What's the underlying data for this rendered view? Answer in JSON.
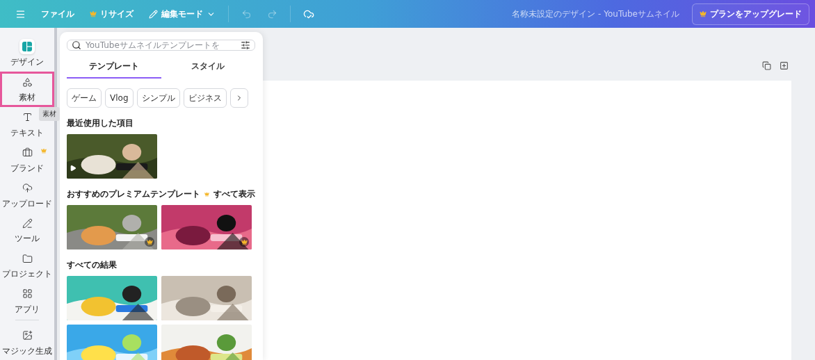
{
  "topbar": {
    "menu_items": [
      {
        "label": "ファイル",
        "crown": false
      },
      {
        "label": "リサイズ",
        "crown": true
      }
    ],
    "edit_mode": "編集モード",
    "undo_enabled": false,
    "redo_enabled": false,
    "document_title": "名称未設定のデザイン - YouTubeサムネイル",
    "upgrade_button": "プランをアップグレード"
  },
  "sidebar": {
    "items": [
      {
        "kind": "design",
        "label": "デザイン",
        "selected": true,
        "highlighted": false,
        "crown": false
      },
      {
        "kind": "elements",
        "label": "素材",
        "selected": false,
        "highlighted": true,
        "crown": false
      },
      {
        "kind": "text",
        "label": "テキスト",
        "selected": false,
        "highlighted": false,
        "crown": false
      },
      {
        "kind": "brand",
        "label": "ブランド",
        "selected": false,
        "highlighted": false,
        "crown": true
      },
      {
        "kind": "upload",
        "label": "アップロード",
        "selected": false,
        "highlighted": false,
        "crown": false
      },
      {
        "kind": "tools",
        "label": "ツール",
        "selected": false,
        "highlighted": false,
        "crown": false
      },
      {
        "kind": "projects",
        "label": "プロジェクト",
        "selected": false,
        "highlighted": false,
        "crown": false
      },
      {
        "kind": "apps",
        "label": "アプリ",
        "selected": false,
        "highlighted": false,
        "crown": false
      },
      {
        "kind": "magic",
        "label": "マジック生成",
        "selected": false,
        "highlighted": false,
        "crown": false
      }
    ],
    "tooltip": "素材"
  },
  "panel": {
    "search": {
      "placeholder": "YouTubeサムネイルテンプレートを"
    },
    "tabs": [
      {
        "label": "テンプレート",
        "selected": true
      },
      {
        "label": "スタイル",
        "selected": false
      }
    ],
    "chips": [
      "ゲーム",
      "Vlog",
      "シンプル",
      "ビジネス"
    ],
    "recent": {
      "title": "最近使用した項目",
      "items": [
        {
          "kind": "picture",
          "video": true
        }
      ]
    },
    "premium": {
      "title": "おすすめのプレミアムテンプレート",
      "see_all": "すべて表示",
      "items": [
        {
          "kind": "picture",
          "premium": true
        },
        {
          "kind": "picture",
          "premium": true
        }
      ]
    },
    "results": {
      "title": "すべての結果",
      "items": [
        {
          "kind": "picture"
        },
        {
          "kind": "picture"
        },
        {
          "kind": "picture"
        },
        {
          "kind": "picture"
        }
      ]
    }
  }
}
